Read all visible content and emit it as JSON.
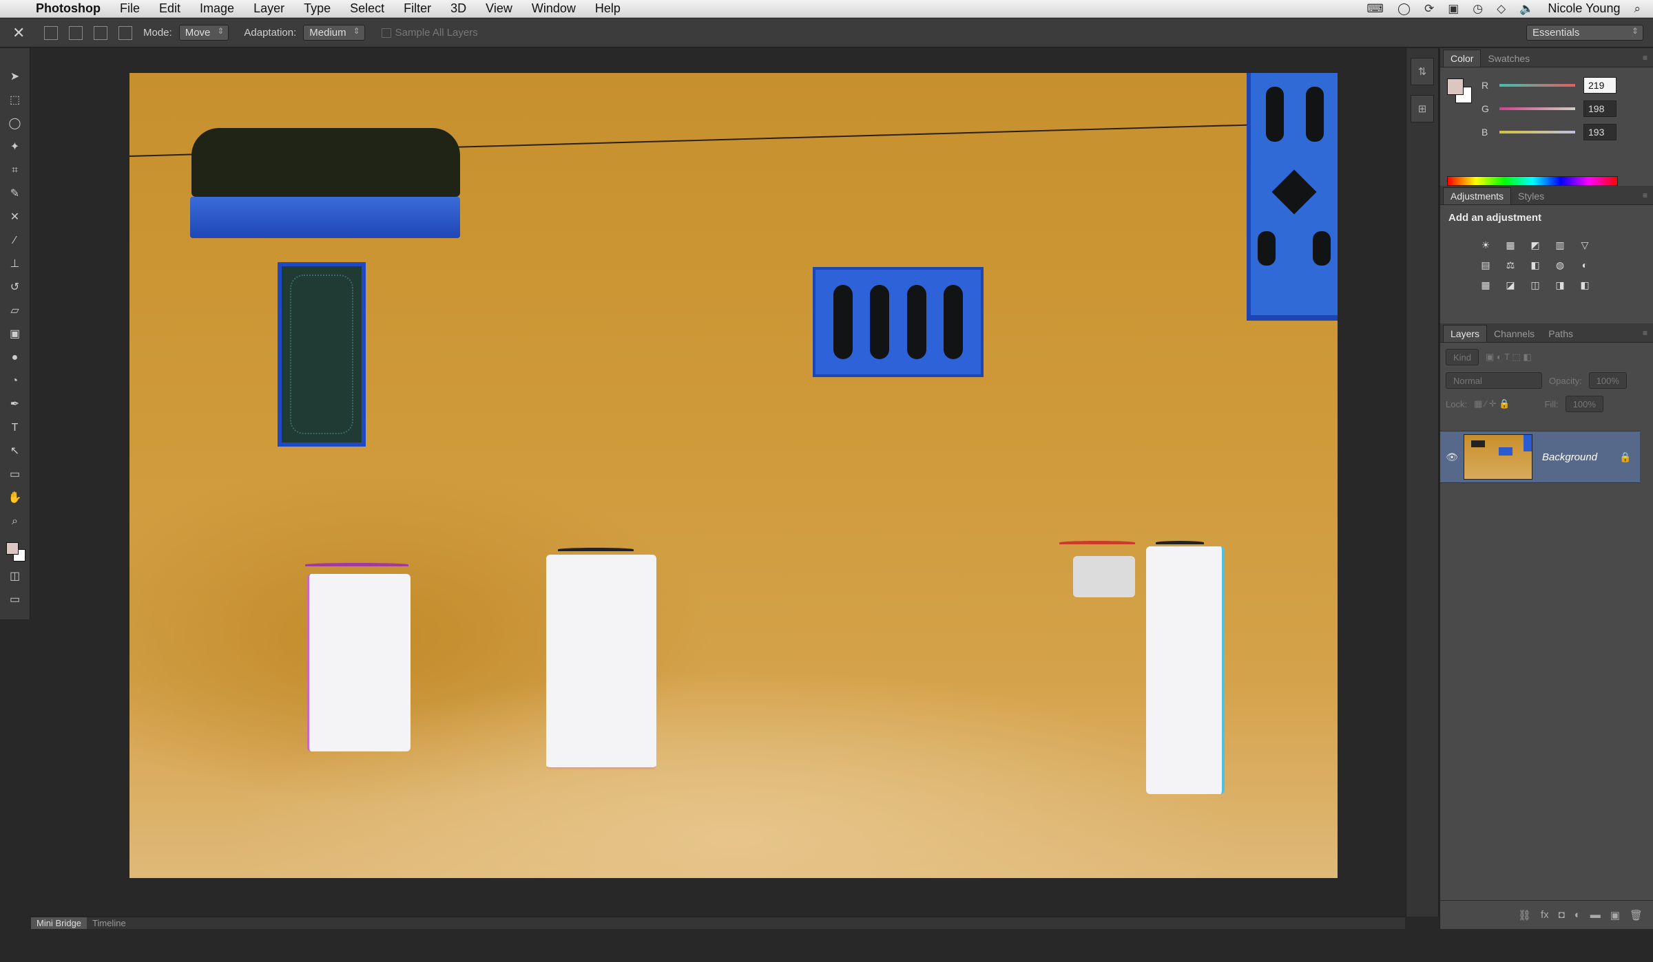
{
  "menubar": {
    "app": "Photoshop",
    "menus": [
      "File",
      "Edit",
      "Image",
      "Layer",
      "Type",
      "Select",
      "Filter",
      "3D",
      "View",
      "Window",
      "Help"
    ],
    "user": "Nicole Young"
  },
  "options": {
    "mode_label": "Mode:",
    "mode_value": "Move",
    "adaptation_label": "Adaptation:",
    "adaptation_value": "Medium",
    "sample_all_layers": "Sample All Layers",
    "workspace": "Essentials"
  },
  "color_panel": {
    "tabs": [
      "Color",
      "Swatches"
    ],
    "active_tab": "Color",
    "channels": [
      {
        "label": "R",
        "value": "219",
        "track": "#c0392b"
      },
      {
        "label": "G",
        "value": "198",
        "track": "#2ecc71"
      },
      {
        "label": "B",
        "value": "193",
        "track": "#2f6bd6"
      }
    ],
    "foreground": "#dbc6c1",
    "background": "#ffffff"
  },
  "adjustments_panel": {
    "tabs": [
      "Adjustments",
      "Styles"
    ],
    "title": "Add an adjustment",
    "icons": [
      "☀",
      "▦",
      "◩",
      "▥",
      "▽",
      "▤",
      "⚖",
      "◧",
      "◍",
      "◐",
      "▦",
      "◪",
      "◫",
      "◨",
      "◧"
    ]
  },
  "layers_panel": {
    "tabs": [
      "Layers",
      "Channels",
      "Paths"
    ],
    "kind": "Kind",
    "blend": "Normal",
    "opacity_label": "Opacity:",
    "opacity_value": "100%",
    "lock_label": "Lock:",
    "fill_label": "Fill:",
    "fill_value": "100%",
    "layers": [
      {
        "name": "Background",
        "locked": true,
        "visible": true
      }
    ]
  },
  "bottom_tabs": [
    "Mini Bridge",
    "Timeline"
  ]
}
